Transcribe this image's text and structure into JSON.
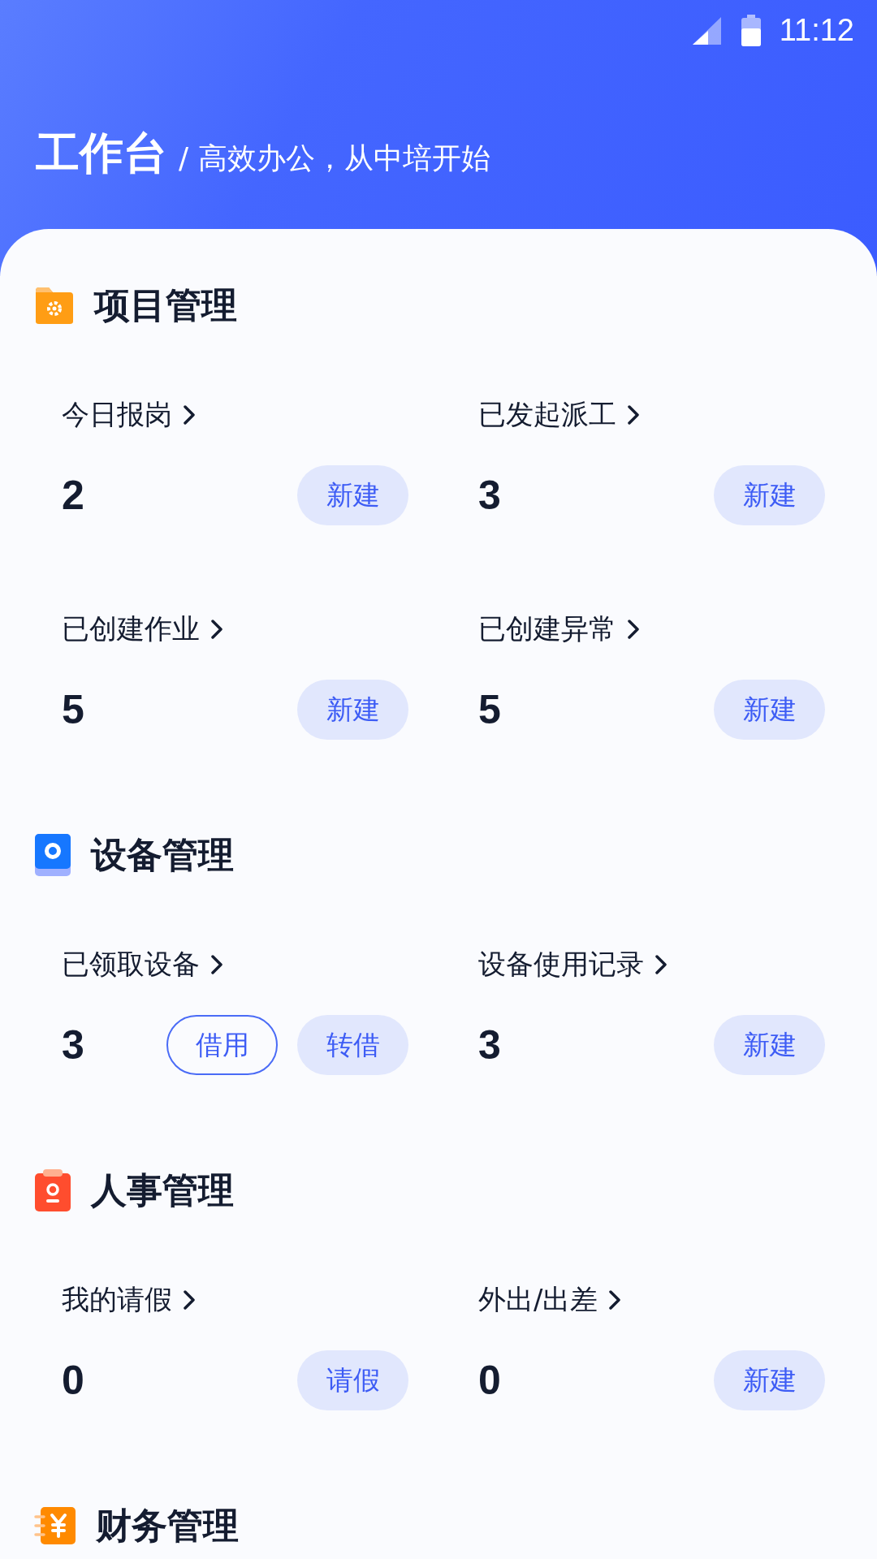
{
  "status_bar": {
    "time": "11:12"
  },
  "header": {
    "title": "工作台",
    "subtitle": "/ 高效办公，从中培开始"
  },
  "sections": [
    {
      "title": "项目管理",
      "items": [
        {
          "label": "今日报岗",
          "count": "2",
          "actions": [
            {
              "label": "新建",
              "kind": "filled"
            }
          ]
        },
        {
          "label": "已发起派工",
          "count": "3",
          "actions": [
            {
              "label": "新建",
              "kind": "filled"
            }
          ]
        },
        {
          "label": "已创建作业",
          "count": "5",
          "actions": [
            {
              "label": "新建",
              "kind": "filled"
            }
          ]
        },
        {
          "label": "已创建异常",
          "count": "5",
          "actions": [
            {
              "label": "新建",
              "kind": "filled"
            }
          ]
        }
      ]
    },
    {
      "title": "设备管理",
      "items": [
        {
          "label": "已领取设备",
          "count": "3",
          "actions": [
            {
              "label": "借用",
              "kind": "outline"
            },
            {
              "label": "转借",
              "kind": "filled"
            }
          ]
        },
        {
          "label": "设备使用记录",
          "count": "3",
          "actions": [
            {
              "label": "新建",
              "kind": "filled"
            }
          ]
        }
      ]
    },
    {
      "title": "人事管理",
      "items": [
        {
          "label": "我的请假",
          "count": "0",
          "actions": [
            {
              "label": "请假",
              "kind": "filled"
            }
          ]
        },
        {
          "label": "外出/出差",
          "count": "0",
          "actions": [
            {
              "label": "新建",
              "kind": "filled"
            }
          ]
        }
      ]
    },
    {
      "title": "财务管理"
    }
  ]
}
